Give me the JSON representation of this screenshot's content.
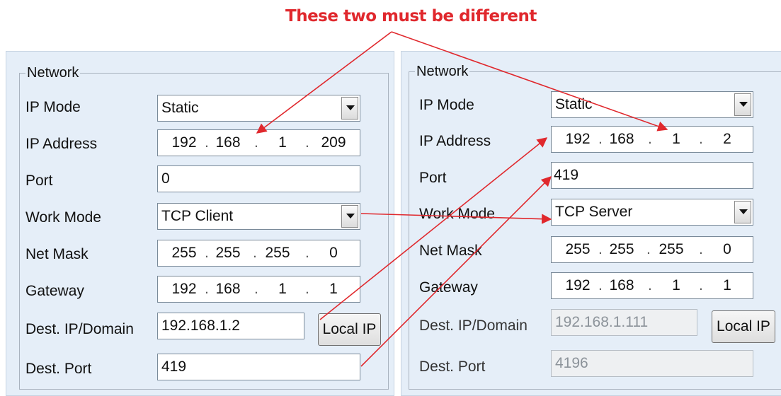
{
  "annotation": "These two must be different",
  "left": {
    "legend": "Network",
    "labels": {
      "ip_mode": "IP Mode",
      "ip_address": "IP Address",
      "port": "Port",
      "work_mode": "Work Mode",
      "net_mask": "Net Mask",
      "gateway": "Gateway",
      "dest_ip": "Dest. IP/Domain",
      "dest_port": "Dest. Port"
    },
    "ip_mode": "Static",
    "ip_address": [
      "192",
      "168",
      "1",
      "209"
    ],
    "port": "0",
    "work_mode": "TCP Client",
    "net_mask": [
      "255",
      "255",
      "255",
      "0"
    ],
    "gateway": [
      "192",
      "168",
      "1",
      "1"
    ],
    "dest_ip": "192.168.1.2",
    "local_ip_button": "Local IP",
    "dest_port": "419"
  },
  "right": {
    "legend": "Network",
    "labels": {
      "ip_mode": "IP Mode",
      "ip_address": "IP Address",
      "port": "Port",
      "work_mode": "Work Mode",
      "net_mask": "Net Mask",
      "gateway": "Gateway",
      "dest_ip": "Dest. IP/Domain",
      "dest_port": "Dest. Port"
    },
    "ip_mode": "Static",
    "ip_address": [
      "192",
      "168",
      "1",
      "2"
    ],
    "port": "419",
    "work_mode": "TCP Server",
    "net_mask": [
      "255",
      "255",
      "255",
      "0"
    ],
    "gateway": [
      "192",
      "168",
      "1",
      "1"
    ],
    "dest_ip": "192.168.1.111",
    "local_ip_button": "Local IP",
    "dest_port": "4196"
  },
  "colors": {
    "annotation": "#e0282d",
    "panel_bg": "#e5eef8"
  }
}
